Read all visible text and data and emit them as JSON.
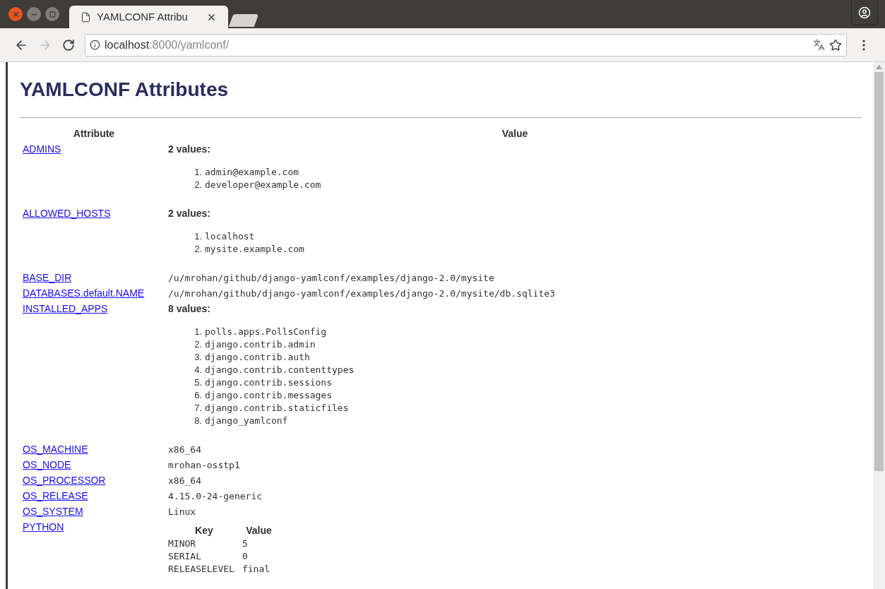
{
  "browser": {
    "tabs": [
      {
        "title": "YAMLCONF Attribu",
        "selected": true,
        "kind": "page"
      },
      {
        "selected": false,
        "kind": "new"
      }
    ],
    "address": {
      "host": "localhost",
      "path": ":8000/yamlconf/"
    }
  },
  "page": {
    "heading": "YAMLCONF Attributes",
    "columns": [
      "Attribute",
      "Value"
    ],
    "rows": [
      {
        "name": "ADMINS",
        "kind": "list",
        "summary": "2 values:",
        "items": [
          {
            "number": "1.",
            "text": "admin@example.com"
          },
          {
            "number": "2.",
            "text": "developer@example.com"
          }
        ]
      },
      {
        "name": "ALLOWED_HOSTS",
        "kind": "list",
        "summary": "2 values:",
        "items": [
          {
            "number": "1.",
            "text": "localhost"
          },
          {
            "number": "2.",
            "text": "mysite.example.com"
          }
        ]
      },
      {
        "name": "BASE_DIR",
        "kind": "text",
        "value": "/u/mrohan/github/django-yamlconf/examples/django-2.0/mysite"
      },
      {
        "name": "DATABASES.default.NAME",
        "kind": "text",
        "value": "/u/mrohan/github/django-yamlconf/examples/django-2.0/mysite/db.sqlite3"
      },
      {
        "name": "INSTALLED_APPS",
        "kind": "list",
        "summary": "8 values:",
        "items": [
          {
            "number": "1.",
            "text": "polls.apps.PollsConfig"
          },
          {
            "number": "2.",
            "text": "django.contrib.admin"
          },
          {
            "number": "3.",
            "text": "django.contrib.auth"
          },
          {
            "number": "4.",
            "text": "django.contrib.contenttypes"
          },
          {
            "number": "5.",
            "text": "django.contrib.sessions"
          },
          {
            "number": "6.",
            "text": "django.contrib.messages"
          },
          {
            "number": "7.",
            "text": "django.contrib.staticfiles"
          },
          {
            "number": "8.",
            "text": "django_yamlconf"
          }
        ]
      },
      {
        "name": "OS_MACHINE",
        "kind": "text",
        "value": "x86_64"
      },
      {
        "name": "OS_NODE",
        "kind": "text",
        "value": "mrohan-osstp1"
      },
      {
        "name": "OS_PROCESSOR",
        "kind": "text",
        "value": "x86_64"
      },
      {
        "name": "OS_RELEASE",
        "kind": "text",
        "value": "4.15.0-24-generic"
      },
      {
        "name": "OS_SYSTEM",
        "kind": "text",
        "value": "Linux"
      },
      {
        "name": "PYTHON",
        "kind": "dict",
        "columns": [
          "Key",
          "Value"
        ],
        "entries": [
          [
            "MINOR",
            "5"
          ],
          [
            "SERIAL",
            "0"
          ],
          [
            "RELEASELEVEL",
            "final"
          ]
        ]
      }
    ]
  }
}
